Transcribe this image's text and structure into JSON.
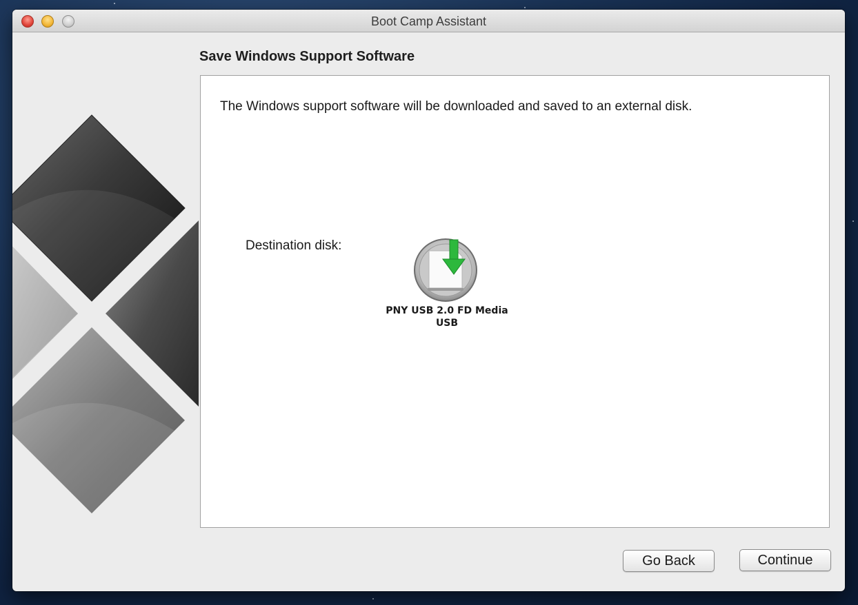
{
  "window": {
    "title": "Boot Camp Assistant"
  },
  "page": {
    "title": "Save Windows Support Software",
    "intro": "The Windows support software will be downloaded and saved to an external disk.",
    "destination_label": "Destination disk:"
  },
  "disk": {
    "name": "PNY USB 2.0 FD Media\nUSB",
    "icon": "usb-download-icon"
  },
  "buttons": {
    "back_label": "Go Back",
    "continue_label": "Continue"
  },
  "colors": {
    "accent_green": "#2db83d",
    "panel": "#ffffff",
    "window_bg": "#ececec"
  }
}
